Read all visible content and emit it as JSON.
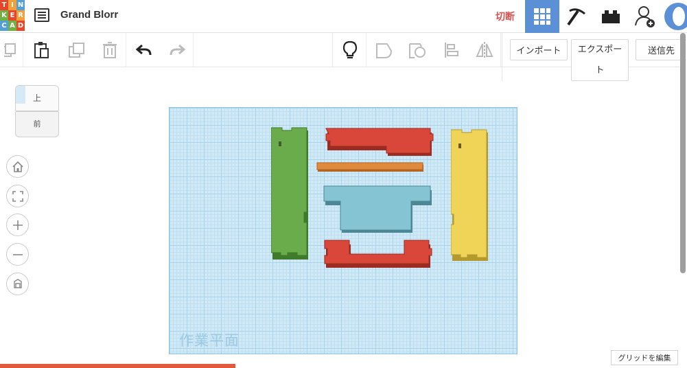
{
  "logo": {
    "letters": [
      "T",
      "I",
      "N",
      "K",
      "E",
      "R",
      "C",
      "A",
      "D"
    ],
    "colors": [
      "#e8462b",
      "#f3a03a",
      "#52a0d4",
      "#6fb241",
      "#e8462b",
      "#f3a03a",
      "#52a0d4",
      "#6fb241",
      "#e8462b"
    ]
  },
  "header": {
    "design_name": "Grand Blorr",
    "cut_label": "切断",
    "icons": {
      "menu": "list-icon",
      "grid_view": "grid-view-icon",
      "pickaxe": "pickaxe-icon",
      "bricks": "brick-icon",
      "add_user": "add-user-icon"
    }
  },
  "toolbar": {
    "import_label": "インポート",
    "export_label": "エクスポート",
    "send_label": "送信先"
  },
  "viewcube": {
    "top": "上",
    "front": "前"
  },
  "workplane": {
    "label": "作業平面",
    "edit_grid_label": "グリッドを編集"
  },
  "colors": {
    "accent": "#5b8fd6",
    "cut": "#d9534f",
    "green": "#6aab4b",
    "red": "#d9473a",
    "orange": "#e08a3e",
    "teal": "#85c4d3",
    "yellow": "#f0d458"
  }
}
